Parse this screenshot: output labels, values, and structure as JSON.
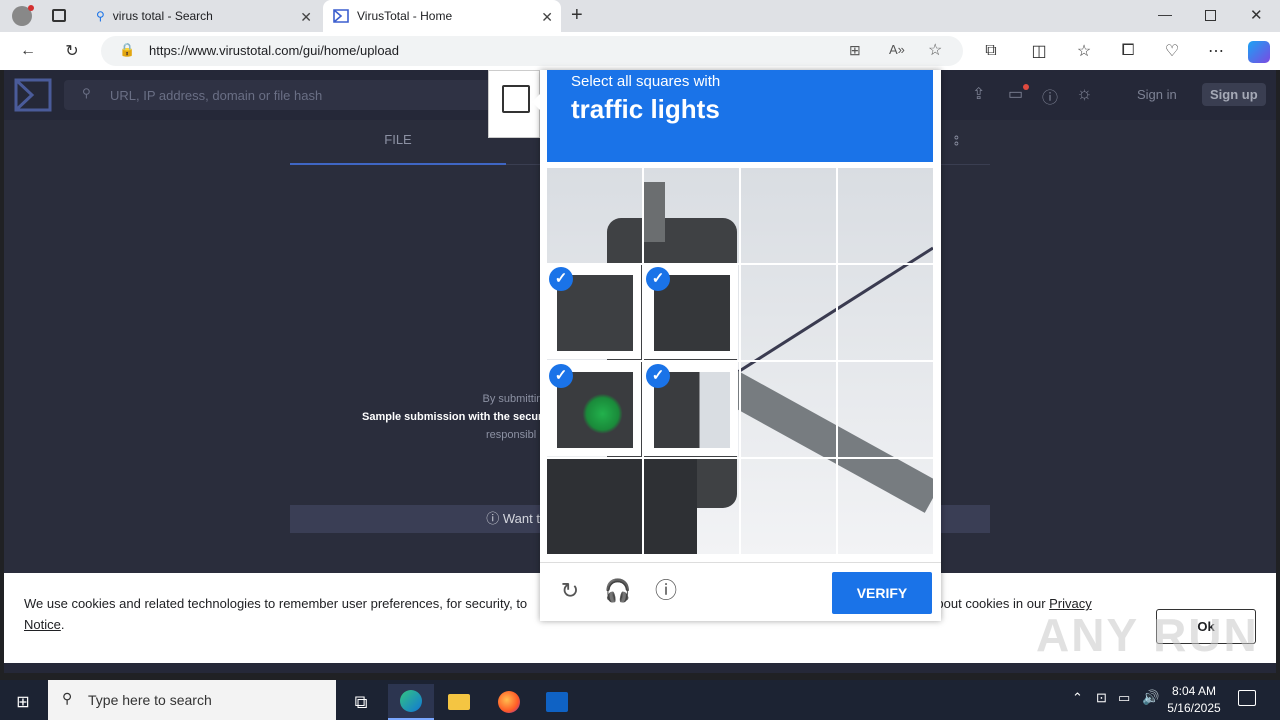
{
  "browser": {
    "tabs": [
      {
        "title": "virus total - Search"
      },
      {
        "title": "VirusTotal - Home"
      }
    ],
    "url": "https://www.virustotal.com/gui/home/upload"
  },
  "vt": {
    "search_placeholder": "URL, IP address, domain or file hash",
    "signin": "Sign in",
    "signup": "Sign up",
    "file_tab": "FILE",
    "legal_line1": "By submitting data above, you are a",
    "legal_line2": "Sample submission with the secur",
    "legal_line3": "responsibl",
    "automate": "ⓘ Want to automat"
  },
  "captcha": {
    "instruction": "Select all squares with",
    "target": "traffic lights",
    "verify_label": "VERIFY"
  },
  "cookie": {
    "text_start": "We use cookies and related technologies to remember user preferences, for security, to",
    "text_end": "about cookies in our ",
    "link1": "Privacy",
    "link2": "Notice",
    "period": ".",
    "ok_label": "Ok"
  },
  "watermark": "ANY RUN",
  "taskbar": {
    "search_placeholder": "Type here to search",
    "time": "8:04 AM",
    "date": "5/16/2025"
  }
}
